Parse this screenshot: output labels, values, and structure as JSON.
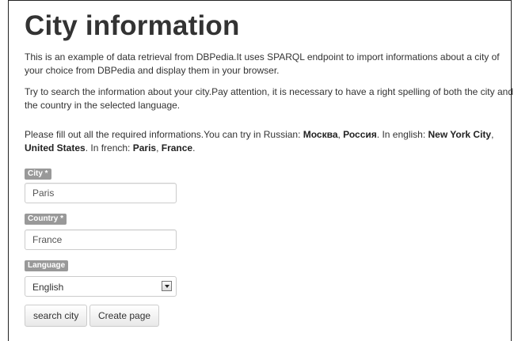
{
  "page": {
    "title": "City information",
    "intro": "This is an example of data retrieval from DBPedia.It uses SPARQL endpoint to import informations about a city of your choice from DBPedia and display them in your browser.",
    "tip": "Try to search the information about your city.Pay attention, it is necessary to have a right spelling of both the city and the country in the selected language.",
    "examples": {
      "prefix": "Please fill out all the required informations.You can try in Russian: ",
      "ru_city": "Москва",
      "sep1": ", ",
      "ru_country": "Россия",
      "mid1": ". In english: ",
      "en_city": "New York City",
      "sep2": ", ",
      "en_country": "United States",
      "mid2": ". In french: ",
      "fr_city": "Paris",
      "sep3": ", ",
      "fr_country": "France",
      "end": "."
    }
  },
  "form": {
    "city_label": "City *",
    "city_value": "Paris",
    "country_label": "Country *",
    "country_value": "France",
    "language_label": "Language",
    "language_value": "English",
    "search_button": "search city",
    "create_button": "Create page"
  }
}
